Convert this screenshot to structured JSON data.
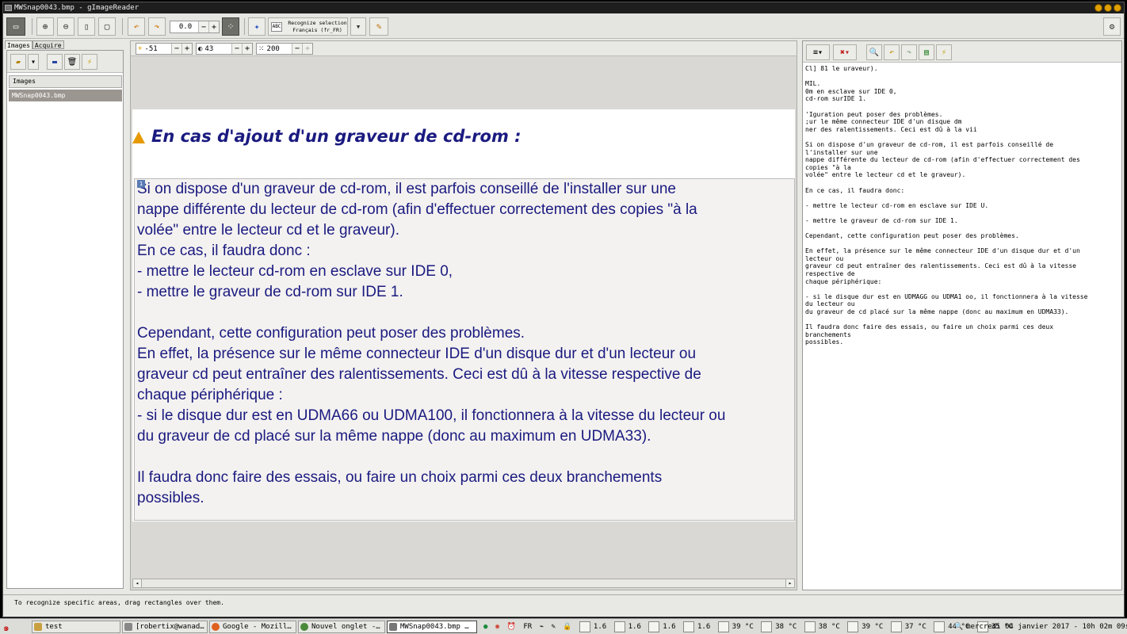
{
  "window": {
    "title": "MWSnap0043.bmp - gImageReader"
  },
  "toolbar": {
    "rotation_value": "0.0",
    "recognize_label": "Recognize selection",
    "recognize_lang": "Français (fr_FR)",
    "abc_icon_text": "ABC"
  },
  "left": {
    "tabs": [
      "Images",
      "Acquire"
    ],
    "list_header": "Images",
    "items": [
      "MWSnap0043.bmp"
    ]
  },
  "center": {
    "brightness": "-51",
    "contrast": "43",
    "resolution": "200",
    "selection_number": "1",
    "heading": "En cas d'ajout d'un graveur de cd-rom :",
    "lines": [
      "Si on dispose d'un graveur de cd-rom, il est parfois conseillé de l'installer sur une",
      "nappe différente du lecteur de cd-rom (afin d'effectuer correctement des copies \"à la",
      "volée\" entre le lecteur cd et le graveur).",
      "En ce cas, il faudra donc :",
      "- mettre le lecteur cd-rom en esclave sur IDE 0,",
      "- mettre le graveur de cd-rom sur IDE 1.",
      "",
      "Cependant, cette configuration peut poser des problèmes.",
      "En effet, la présence sur le même connecteur IDE d'un disque dur et d'un lecteur ou",
      "graveur cd peut entraîner des ralentissements. Ceci est dû à la vitesse respective de",
      "chaque périphérique :",
      "- si le disque dur est en UDMA66 ou UDMA100, il fonctionnera à la vitesse du lecteur ou",
      "du graveur de cd placé sur la même nappe (donc au maximum en UDMA33).",
      "",
      "Il faudra donc faire des essais, ou faire un choix parmi ces deux branchements",
      "possibles."
    ]
  },
  "output": {
    "text": "Cl] 81 le uraveur).\n\nMIL.\n0m en esclave sur IDE 0,\ncd-rom surIDE 1.\n\n'Iguration peut poser des problèmes.\n;ur le même connecteur IDE d'un disque dm\nner des ralentissements. Ceci est dû à la vii\n\nSi on dispose d'un graveur de cd-rom, il est parfois conseillé de\nl'installer sur une\nnappe différente du lecteur de cd-rom (afin d'effectuer correctement des\ncopies \"à la\nvolée\" entre le lecteur cd et le graveur).\n\nEn ce cas, il faudra donc:\n\n- mettre le lecteur cd-rom en esclave sur IDE U.\n\n- mettre le graveur de cd-rom sur IDE 1.\n\nCependant, cette configuration peut poser des problèmes.\n\nEn effet, la présence sur le même connecteur IDE d'un disque dur et d'un\nlecteur ou\ngraveur cd peut entraîner des ralentissements. Ceci est dû à la vitesse\nrespective de\nchaque périphérique:\n\n- si le disque dur est en UDMAGG ou UDMA1 oo, il fonctionnera à la vitesse\ndu lecteur ou\ndu graveur de cd placé sur la même nappe (donc au maximum en UDMA33).\n\nIl faudra donc faire des essais, ou faire un choix parmi ces deux\nbranchements\npossibles."
  },
  "status": {
    "text": "To recognize specific areas, drag rectangles over them."
  },
  "taskbar": {
    "items": [
      "test",
      "[robertix@wanad…",
      "Google - Mozill…",
      "Nouvel onglet -…",
      "MWSnap0043.bmp …"
    ],
    "lang": "FR",
    "temps": [
      "1.6",
      "1.6",
      "1.6",
      "1.6",
      "39 °C",
      "38 °C",
      "38 °C",
      "39 °C",
      "37 °C",
      "44 °C",
      "35 °C"
    ],
    "clock": "mercredi 04 janvier 2017 - 10h 02m 09s"
  },
  "colors": {
    "doc_text": "#1a1a80",
    "accent_selected": "#9c9690"
  }
}
